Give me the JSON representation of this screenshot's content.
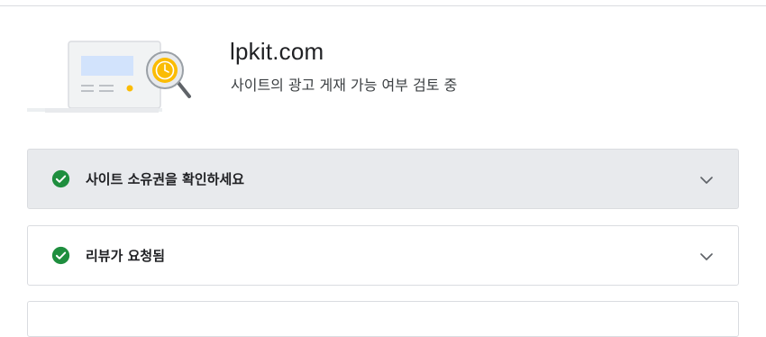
{
  "header": {
    "site": "lpkit.com",
    "status": "사이트의 광고 게재 가능 여부 검토 중"
  },
  "steps": [
    {
      "label": "사이트 소유권을 확인하세요",
      "state": "complete",
      "icon": "check-circle-icon",
      "expand_icon": "chevron-down-icon"
    },
    {
      "label": "리뷰가 요청됨",
      "state": "complete",
      "icon": "check-circle-icon",
      "expand_icon": "chevron-down-icon"
    }
  ],
  "colors": {
    "check_green": "#1e8e3e",
    "active_step_bg": "#e8eaed",
    "border": "#dadce0",
    "clock_yellow": "#fbbc04"
  }
}
